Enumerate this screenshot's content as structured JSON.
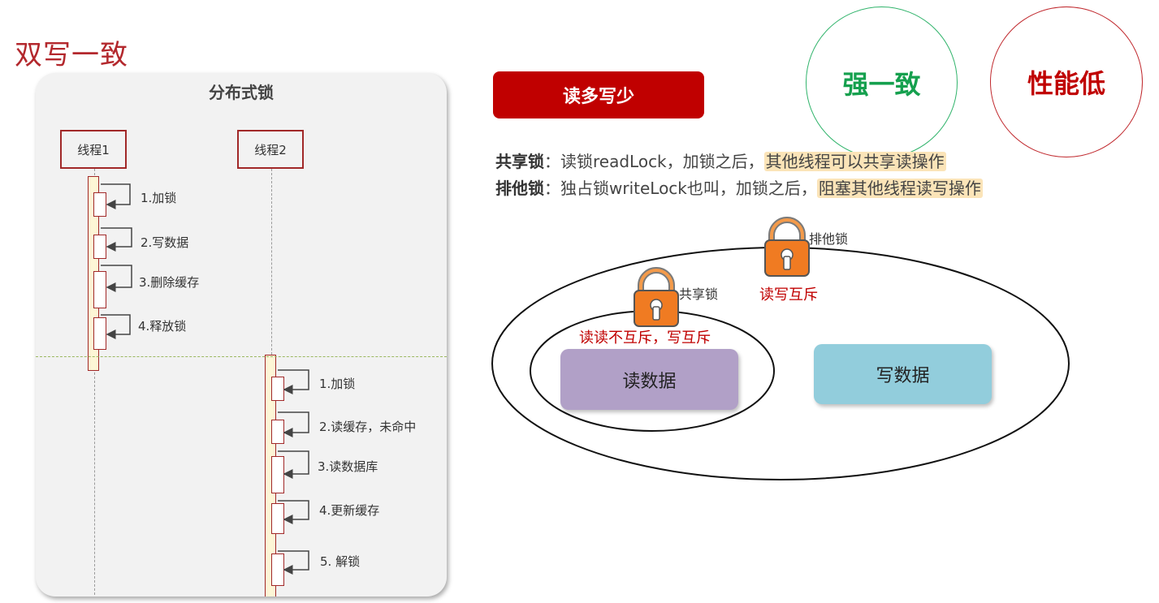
{
  "page": {
    "title": "双写一致"
  },
  "sequence": {
    "title": "分布式锁",
    "thread1": {
      "label": "线程1",
      "steps": [
        "1.加锁",
        "2.写数据",
        "3.删除缓存",
        "4.释放锁"
      ]
    },
    "thread2": {
      "label": "线程2",
      "steps": [
        "1.加锁",
        "2.读缓存，未命中",
        "3.读数据库",
        "4.更新缓存",
        "5. 解锁"
      ]
    }
  },
  "right": {
    "banner": "读多写少",
    "circles": {
      "strong": "强一致",
      "perf": "性能低"
    },
    "shared": {
      "term": "共享锁",
      "colon": "：",
      "text": "读锁readLock，加锁之后，",
      "highlight": "其他线程可以共享读操作"
    },
    "exclusive": {
      "term": "排他锁",
      "colon": "：",
      "text": "独占锁writeLock也叫，加锁之后，",
      "highlight": "阻塞其他线程读写操作"
    },
    "diagram": {
      "exclusive_lock_label": "排他锁",
      "exclusive_lock_note": "读写互斥",
      "shared_lock_label": "共享锁",
      "shared_lock_note": "读读不互斥，写互斥",
      "read_box": "读数据",
      "write_box": "写数据"
    }
  },
  "colors": {
    "accent_red": "#c00000",
    "title_red": "#b3282d",
    "green": "#15a04e",
    "lock_orange": "#f07b22",
    "read_box": "#b1a0c7",
    "write_box": "#92cddc",
    "highlight": "#fbe4b8"
  }
}
